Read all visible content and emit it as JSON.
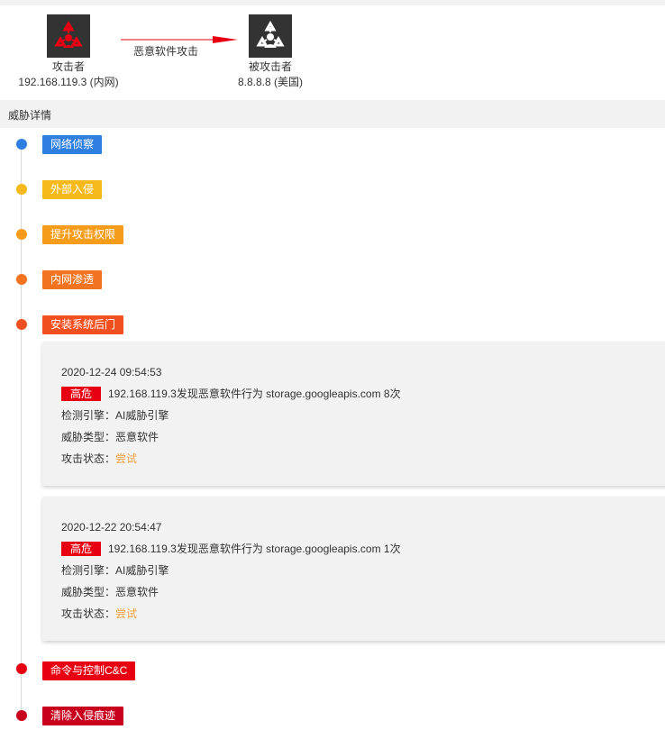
{
  "flow": {
    "attacker": {
      "icon": "biohazard-icon",
      "role": "攻击者",
      "address": "192.168.119.3 (内网)",
      "icon_color": "#e60012"
    },
    "victim": {
      "icon": "person-triangle-icon",
      "role": "被攻击者",
      "address": "8.8.8.8 (美国)",
      "icon_color": "#ffffff"
    },
    "edge_label": "恶意软件攻击",
    "edge_color": "#e60012"
  },
  "section": {
    "title": "威胁详情"
  },
  "stages": [
    {
      "label": "网络侦察",
      "color": "#2f7fe0"
    },
    {
      "label": "外部入侵",
      "color": "#f5b91b"
    },
    {
      "label": "提升攻击权限",
      "color": "#f59d1b"
    },
    {
      "label": "内网渗透",
      "color": "#f27420"
    },
    {
      "label": "安装系统后门",
      "color": "#f0501f"
    },
    {
      "label": "命令与控制C&C",
      "color": "#e60012"
    },
    {
      "label": "清除入侵痕迹",
      "color": "#c8001e"
    }
  ],
  "events": [
    {
      "time": "2020-12-24 09:54:53",
      "level": "高危",
      "summary": "192.168.119.3发现恶意软件行为 storage.googleapis.com 8次",
      "engine_label": "检测引擎：",
      "engine": "AI威胁引擎",
      "type_label": "威胁类型：",
      "type": "恶意软件",
      "status_label": "攻击状态：",
      "status": "尝试"
    },
    {
      "time": "2020-12-22 20:54:47",
      "level": "高危",
      "summary": "192.168.119.3发现恶意软件行为 storage.googleapis.com 1次",
      "engine_label": "检测引擎：",
      "engine": "AI威胁引擎",
      "type_label": "威胁类型：",
      "type": "恶意软件",
      "status_label": "攻击状态：",
      "status": "尝试"
    }
  ]
}
